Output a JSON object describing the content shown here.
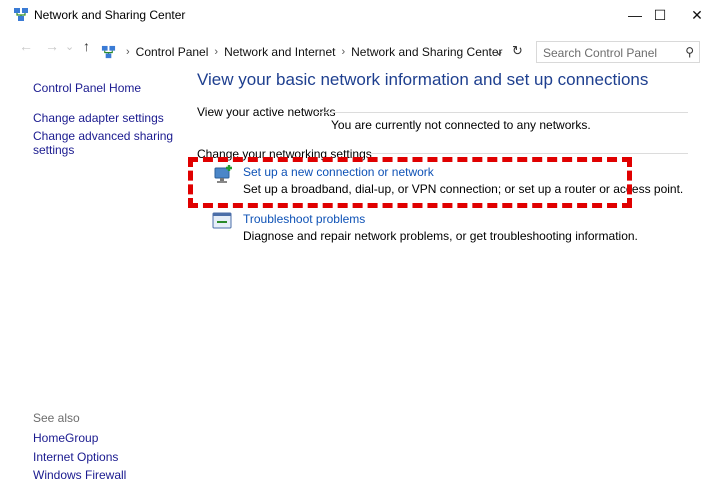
{
  "window": {
    "title": "Network and Sharing Center",
    "minimize_glyph": "—",
    "maximize_glyph": "☐",
    "close_glyph": "✕"
  },
  "address": {
    "back_glyph": "←",
    "forward_glyph": "→",
    "history_glyph": "⌄",
    "up_glyph": "↑",
    "crumbs": [
      "Control Panel",
      "Network and Internet",
      "Network and Sharing Center"
    ],
    "sep": "›",
    "dropdown_glyph": "⌄",
    "refresh_glyph": "↻",
    "search_placeholder": "Search Control Panel",
    "search_glyph": "⚲"
  },
  "sidebar": {
    "home": "Control Panel Home",
    "items": [
      "Change adapter settings",
      "Change advanced sharing",
      "settings"
    ],
    "see_also_label": "See also",
    "see_also": [
      "HomeGroup",
      "Internet Options",
      "Windows Firewall"
    ]
  },
  "main": {
    "heading": "View your basic network information and set up connections",
    "active_networks_label": "View your active networks",
    "not_connected": "You are currently not connected to any networks.",
    "change_settings_label": "Change your networking settings",
    "tasks": [
      {
        "link": "Set up a new connection or network",
        "desc": "Set up a broadband, dial-up, or VPN connection; or set up a router or access point.",
        "icon": "network-setup-icon"
      },
      {
        "link": "Troubleshoot problems",
        "desc": "Diagnose and repair network problems, or get troubleshooting information.",
        "icon": "troubleshoot-icon"
      }
    ]
  },
  "colors": {
    "highlight": "#e00000",
    "link": "#0e52b6",
    "heading": "#1e3f8f"
  }
}
